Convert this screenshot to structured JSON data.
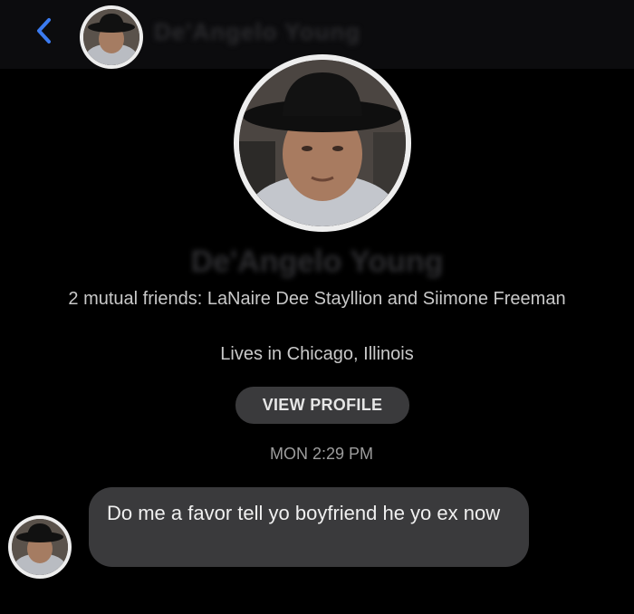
{
  "header": {
    "contact_name": "De'Angelo Young"
  },
  "profile": {
    "name": "De'Angelo Young",
    "mutual_friends": "2 mutual friends: LaNaire Dee Stayllion and Siimone Freeman",
    "location": "Lives in Chicago, Illinois",
    "view_profile_label": "VIEW PROFILE"
  },
  "conversation": {
    "timestamp": "MON 2:29 PM",
    "messages": [
      {
        "text": "Do me a favor tell yo boyfriend he yo ex now"
      }
    ]
  },
  "colors": {
    "accent": "#3b7bf0",
    "background": "#000000",
    "bubble": "#3a3a3c"
  },
  "icons": [
    "back-chevron-icon",
    "avatar"
  ]
}
